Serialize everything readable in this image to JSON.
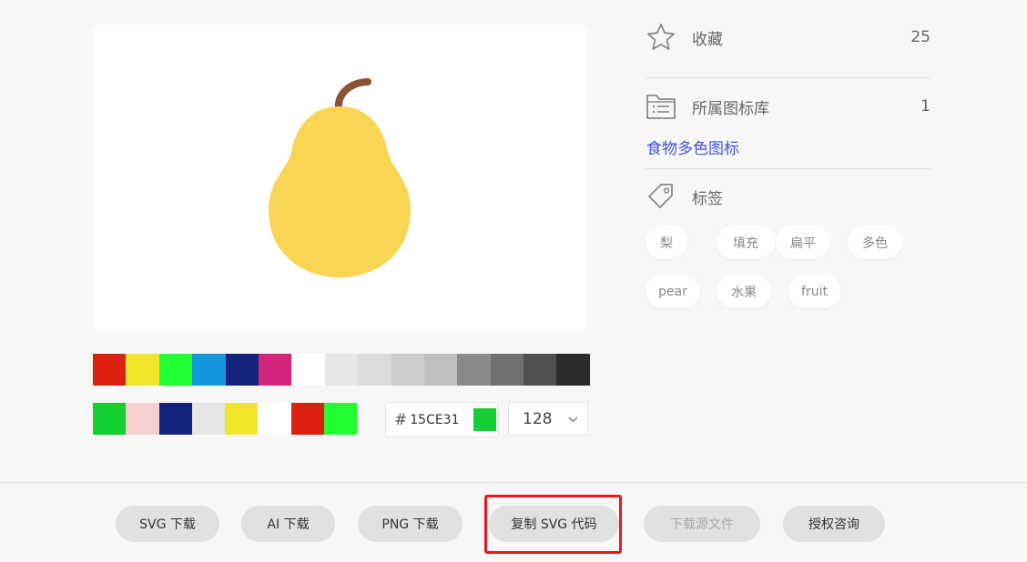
{
  "preview": {
    "icon": "pear-icon",
    "colors": {
      "body": "#F9D554",
      "stem": "#8B5236"
    }
  },
  "palette_top": [
    "#DD2110",
    "#F3E52B",
    "#1FFF31",
    "#1396DB",
    "#13227A",
    "#D4237A",
    "#FFFFFF",
    "#E6E6E6",
    "#DBDBDB",
    "#CDCDCD",
    "#BFBFBF",
    "#8A8A8A",
    "#707070",
    "#515151",
    "#2C2C2C"
  ],
  "palette_bottom": [
    "#15CE31",
    "#F6CFCF",
    "#13227A",
    "#E6E6E6",
    "#F3E52B",
    "#FFFFFF",
    "#DD2110",
    "#1FFF31"
  ],
  "color_input": {
    "hash": "#",
    "value": "15CE31",
    "chip": "#15CE31"
  },
  "size_select": {
    "value": "128"
  },
  "info": {
    "favorite_label": "收藏",
    "favorite_count": "25",
    "library_label": "所属图标库",
    "library_count": "1",
    "library_link": "食物多色图标",
    "tags_label": "标签"
  },
  "tags": [
    "梨",
    "填充",
    "扁平",
    "多色",
    "pear",
    "水果",
    "fruit"
  ],
  "buttons": {
    "svg": "SVG 下载",
    "ai": "AI 下载",
    "png": "PNG 下载",
    "copy_svg": "复制 SVG 代码",
    "source": "下载源文件",
    "license": "授权咨询"
  },
  "colors": {
    "accent_link": "#4355D6",
    "highlight": "#E6181B"
  }
}
